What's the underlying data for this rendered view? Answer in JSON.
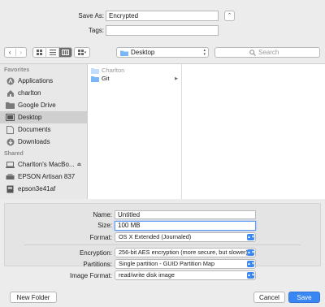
{
  "header": {
    "save_as_label": "Save As:",
    "save_as_value": "Encrypted",
    "tags_label": "Tags:",
    "tags_value": ""
  },
  "toolbar": {
    "location": "Desktop",
    "search_placeholder": "Search"
  },
  "sidebar": {
    "favorites_heading": "Favorites",
    "favorites": [
      {
        "label": "Applications",
        "icon": "applications-icon"
      },
      {
        "label": "charlton",
        "icon": "home-icon"
      },
      {
        "label": "Google Drive",
        "icon": "folder-icon"
      },
      {
        "label": "Desktop",
        "icon": "desktop-icon",
        "selected": true
      },
      {
        "label": "Documents",
        "icon": "document-icon"
      },
      {
        "label": "Downloads",
        "icon": "downloads-icon"
      }
    ],
    "shared_heading": "Shared",
    "shared": [
      {
        "label": "Charlton's MacBo...",
        "icon": "laptop-icon"
      },
      {
        "label": "EPSON Artisan 837",
        "icon": "printer-icon"
      },
      {
        "label": "epson3e41af",
        "icon": "printer-icon"
      }
    ]
  },
  "files": [
    {
      "name": "Charlton",
      "dimmed": true
    },
    {
      "name": "Git",
      "dimmed": false
    }
  ],
  "options": {
    "name_label": "Name:",
    "name_value": "Untitled",
    "size_label": "Size:",
    "size_value": "100 MB",
    "format_label": "Format:",
    "format_value": "OS X Extended (Journaled)",
    "encryption_label": "Encryption:",
    "encryption_value": "256-bit AES encryption (more secure, but slower)",
    "partitions_label": "Partitions:",
    "partitions_value": "Single partition - GUID Partition Map",
    "image_format_label": "Image Format:",
    "image_format_value": "read/write disk image"
  },
  "footer": {
    "new_folder": "New Folder",
    "cancel": "Cancel",
    "save": "Save"
  },
  "colors": {
    "accent": "#3a86f3",
    "sidebar_selected": "#cfcfcf",
    "folder": "#7ab8f5"
  }
}
